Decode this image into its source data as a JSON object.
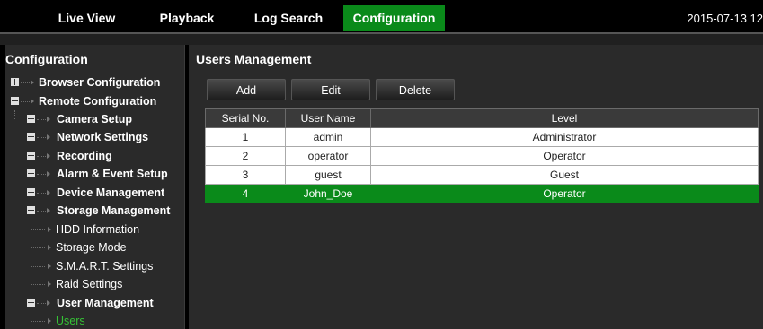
{
  "nav": {
    "tabs": [
      {
        "label": "Live View"
      },
      {
        "label": "Playback"
      },
      {
        "label": "Log Search"
      },
      {
        "label": "Configuration",
        "active": true
      }
    ],
    "datetime": "2015-07-13 12"
  },
  "sidebar": {
    "title": "Configuration",
    "tree": [
      {
        "label": "Browser Configuration",
        "expander": "plus"
      },
      {
        "label": "Remote Configuration",
        "expander": "minus"
      },
      {
        "label": "Camera Setup",
        "expander": "plus"
      },
      {
        "label": "Network Settings",
        "expander": "plus"
      },
      {
        "label": "Recording",
        "expander": "plus"
      },
      {
        "label": "Alarm & Event Setup",
        "expander": "plus"
      },
      {
        "label": "Device Management",
        "expander": "plus"
      },
      {
        "label": "Storage Management",
        "expander": "minus"
      },
      {
        "label": "HDD Information"
      },
      {
        "label": "Storage Mode"
      },
      {
        "label": "S.M.A.R.T. Settings"
      },
      {
        "label": "Raid Settings"
      },
      {
        "label": "User Management",
        "expander": "minus"
      },
      {
        "label": "Users",
        "current": true
      }
    ]
  },
  "main": {
    "title": "Users Management",
    "buttons": {
      "add": "Add",
      "edit": "Edit",
      "delete": "Delete"
    },
    "table": {
      "headers": [
        "Serial No.",
        "User Name",
        "Level"
      ],
      "rows": [
        {
          "serial": "1",
          "name": "admin",
          "level": "Administrator"
        },
        {
          "serial": "2",
          "name": "operator",
          "level": "Operator"
        },
        {
          "serial": "3",
          "name": "guest",
          "level": "Guest"
        },
        {
          "serial": "4",
          "name": "John_Doe",
          "level": "Operator",
          "selected": true
        }
      ]
    }
  },
  "colors": {
    "accent": "#0a8a1a",
    "current_item": "#35c135",
    "panel": "#2a2a2a"
  }
}
